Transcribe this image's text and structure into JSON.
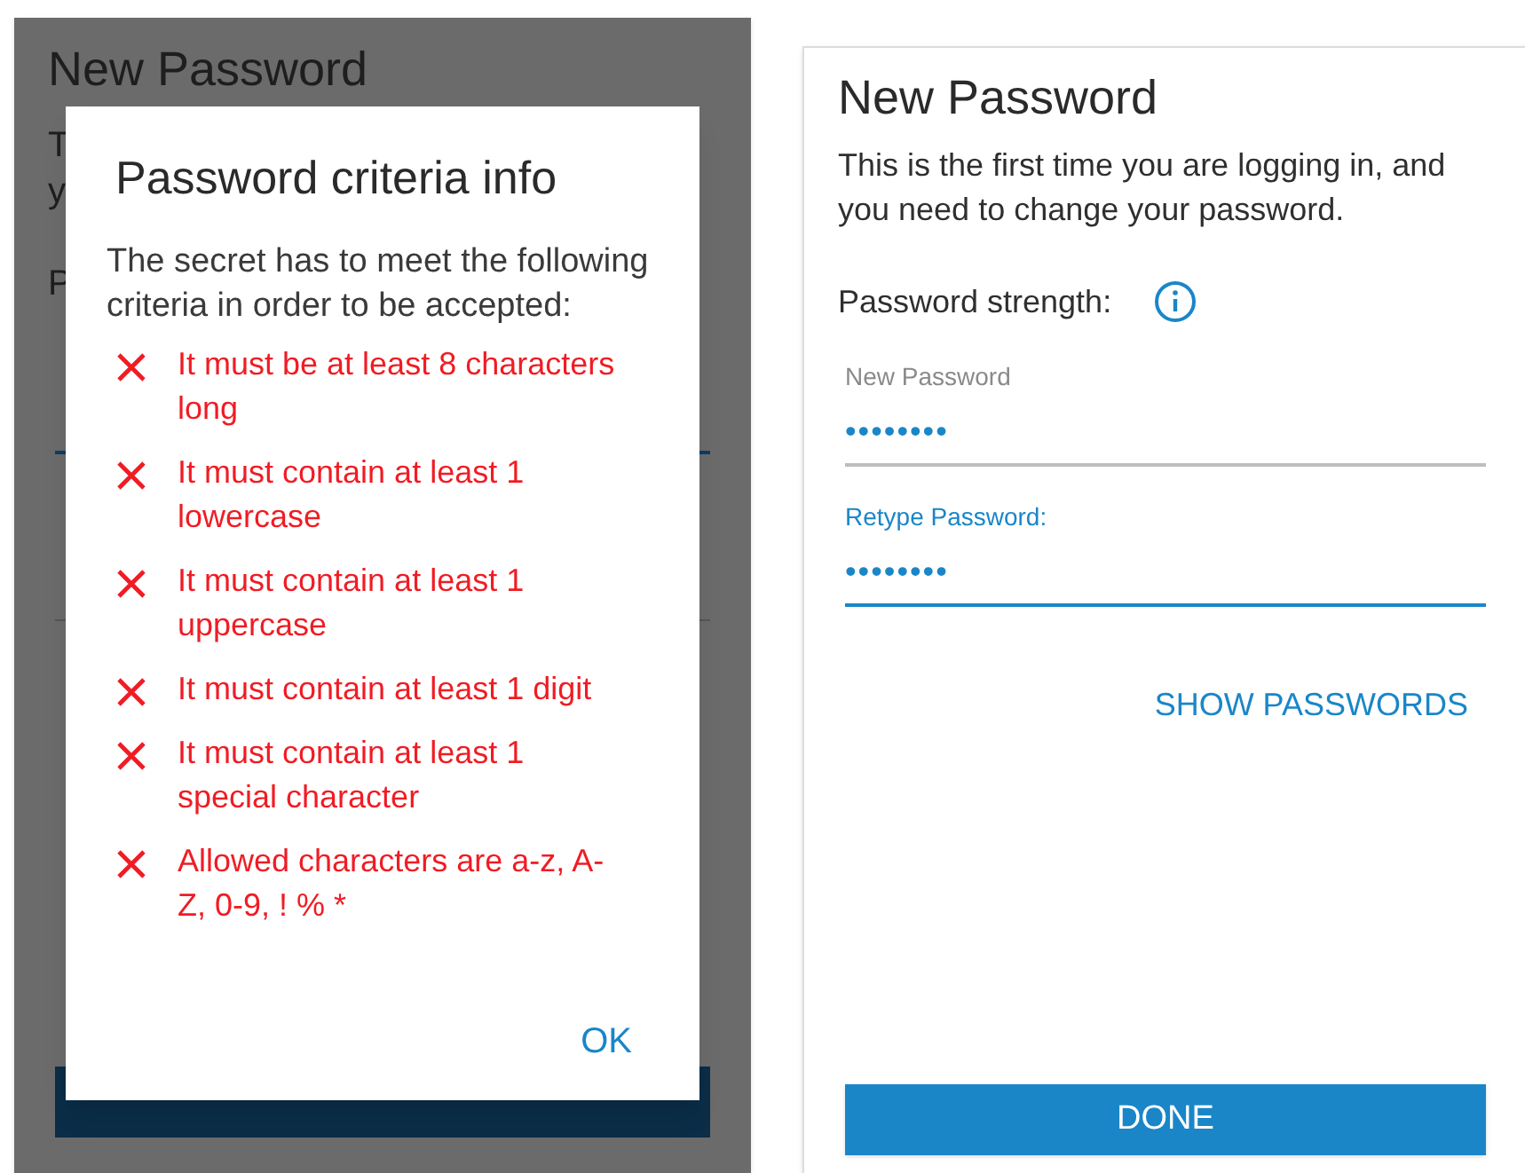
{
  "background_screen": {
    "title": "New Password",
    "fragments": [
      "T",
      "y",
      "P"
    ],
    "fields": [
      {
        "focused": true
      },
      {
        "focused": false
      }
    ]
  },
  "dialog": {
    "title": "Password criteria info",
    "intro": "The secret has to meet the following criteria in order to be accepted:",
    "criteria": [
      {
        "text": "It must be at least 8 characters long",
        "met": false
      },
      {
        "text": "It must contain at least 1 lowercase",
        "met": false
      },
      {
        "text": "It must contain at least 1 uppercase",
        "met": false
      },
      {
        "text": "It must contain at least 1 digit",
        "met": false
      },
      {
        "text": "It must contain at least 1 special character",
        "met": false
      },
      {
        "text": "Allowed characters are a-z, A-Z, 0-9, ! % *",
        "met": false
      }
    ],
    "button": "OK"
  },
  "screen": {
    "title": "New Password",
    "intro": "This is the first time you are logging in, and you need to change your password.",
    "strength_label": "Password strength:",
    "fields": [
      {
        "label": "New Password",
        "value": "••••••••",
        "focused": false
      },
      {
        "label": "Retype Password:",
        "value": "••••••••",
        "focused": true
      }
    ],
    "show_button": "SHOW PASSWORDS",
    "done_button": "DONE"
  }
}
